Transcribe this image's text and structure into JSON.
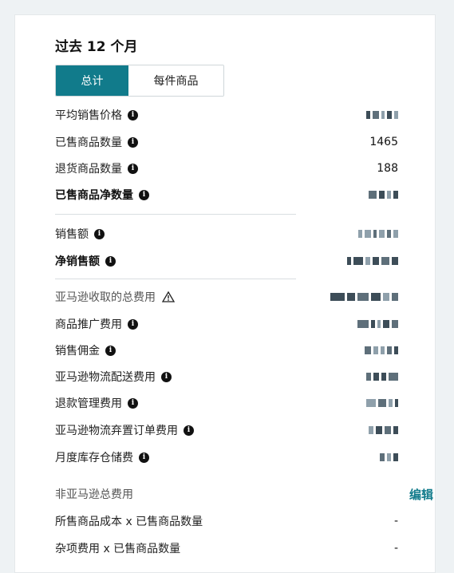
{
  "title": "过去 12 个月",
  "tabs": {
    "total": "总计",
    "per_item": "每件商品"
  },
  "colors": {
    "accent": "#117b8b",
    "text": "#111111"
  },
  "rows": {
    "avg_price": {
      "label": "平均销售价格",
      "icon": "info-icon"
    },
    "units_sold": {
      "label": "已售商品数量",
      "value": "1465",
      "icon": "info-icon"
    },
    "units_returned": {
      "label": "退货商品数量",
      "value": "188",
      "icon": "info-icon"
    },
    "net_units": {
      "label": "已售商品净数量",
      "icon": "info-icon"
    },
    "sales": {
      "label": "销售额",
      "icon": "info-icon"
    },
    "net_sales": {
      "label": "净销售额",
      "icon": "info-icon"
    },
    "amazon_fees": {
      "label": "亚马逊收取的总费用",
      "icon": "warning-icon"
    },
    "promo_fees": {
      "label": "商品推广费用",
      "icon": "info-icon"
    },
    "referral_fees": {
      "label": "销售佣金",
      "icon": "info-icon"
    },
    "fba_fees": {
      "label": "亚马逊物流配送费用",
      "icon": "info-icon"
    },
    "refund_fees": {
      "label": "退款管理费用",
      "icon": "info-icon"
    },
    "disposal_fees": {
      "label": "亚马逊物流弃置订单费用",
      "icon": "info-icon"
    },
    "storage_fees": {
      "label": "月度库存仓储费",
      "icon": "info-icon"
    },
    "non_amazon": {
      "label": "非亚马逊总费用",
      "action": "编辑"
    },
    "cogs": {
      "label": "所售商品成本 x 已售商品数量",
      "value": "-"
    },
    "misc": {
      "label": "杂项费用 x 已售商品数量",
      "value": "-"
    }
  }
}
